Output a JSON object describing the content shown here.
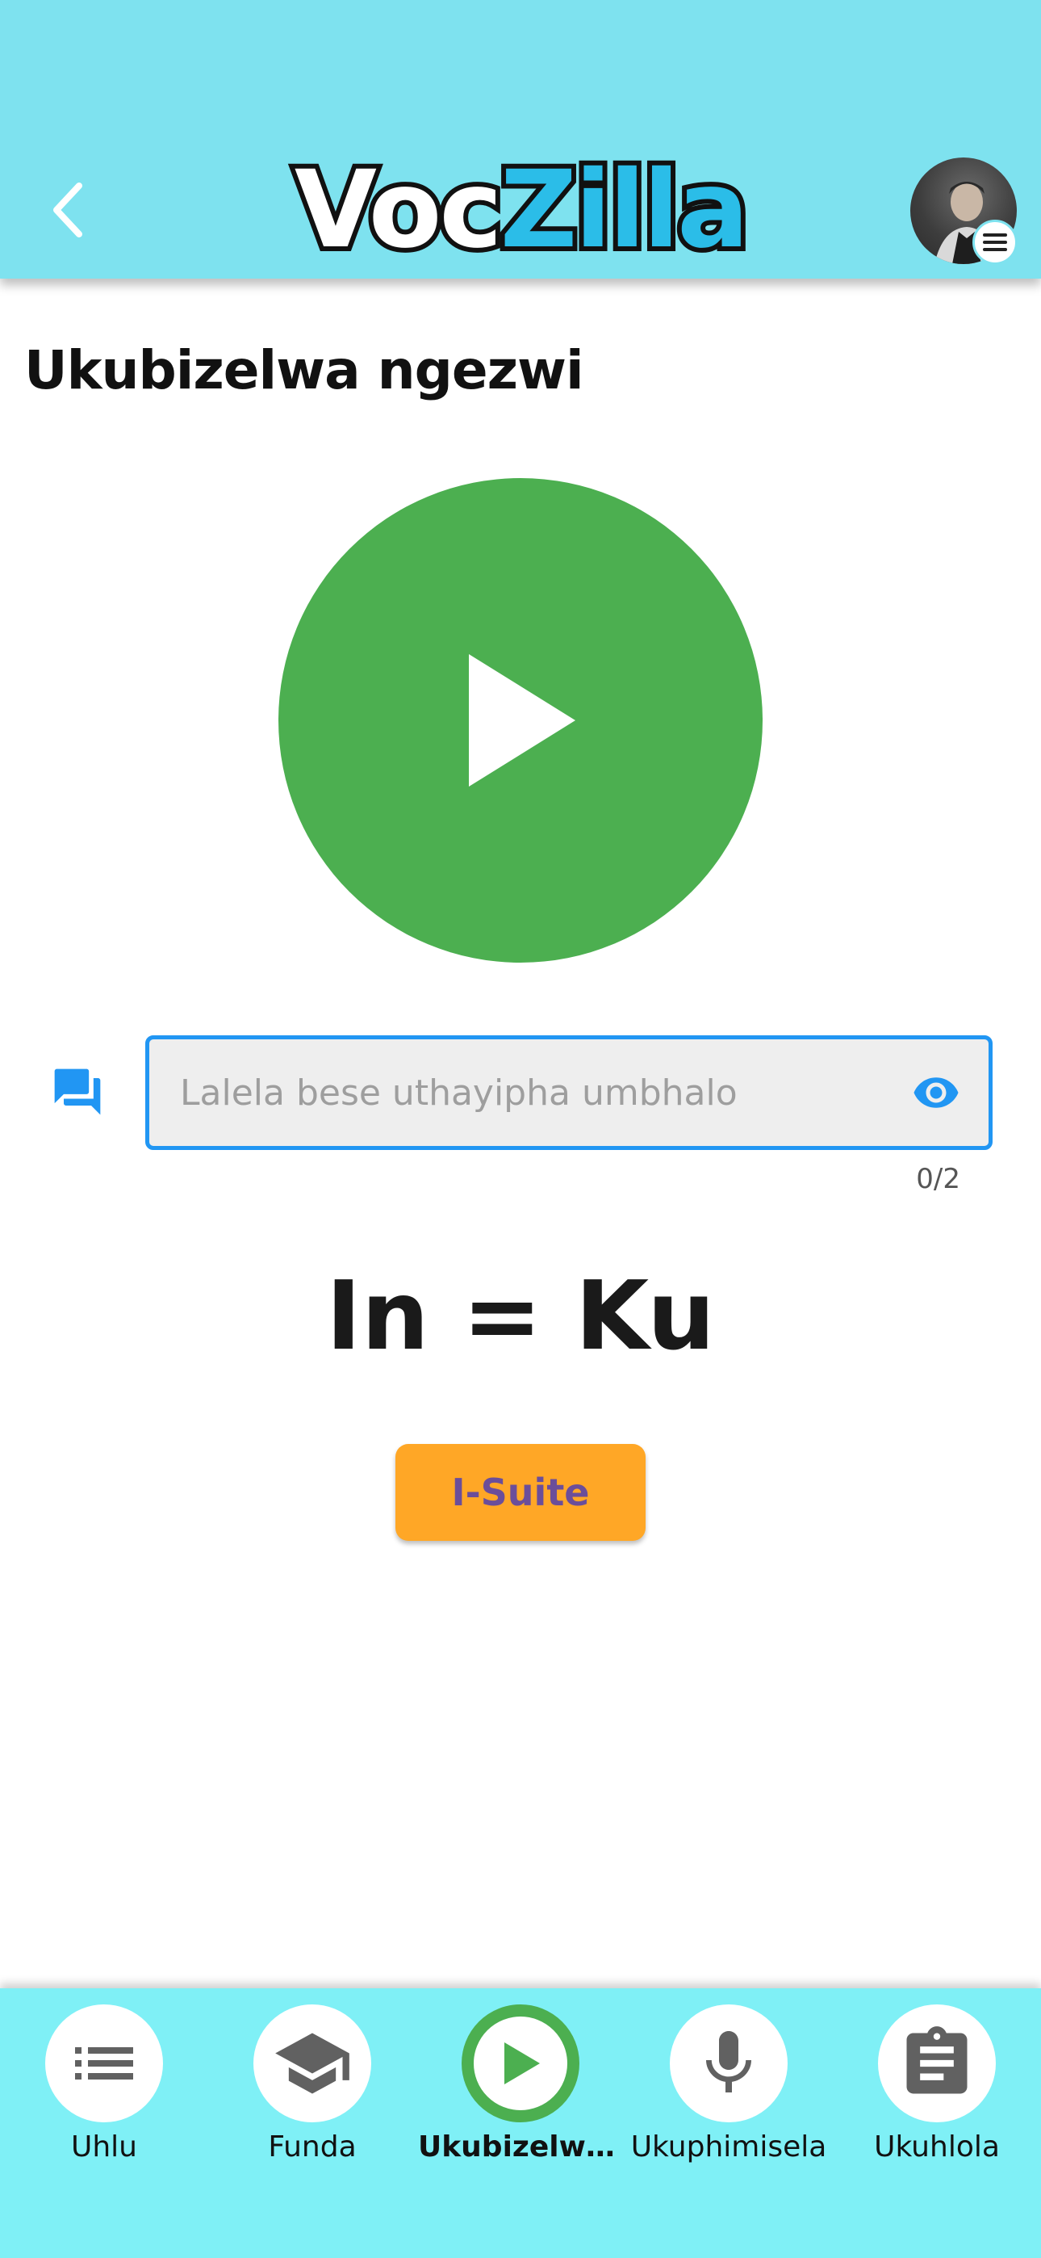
{
  "header": {
    "logo_part1": "Voc",
    "logo_part2": "Zilla",
    "back_icon": "chevron-left-icon",
    "avatar_badge_icon": "menu-icon"
  },
  "page": {
    "title": "Ukubizelwa ngezwi"
  },
  "player": {
    "icon": "play-icon"
  },
  "answer": {
    "placeholder": "Lalela bese uthayipha umbhalo",
    "value": "",
    "counter": "0/2",
    "left_icon": "chat-bubbles-icon",
    "reveal_icon": "eye-icon"
  },
  "rule": {
    "text": "In = Ku"
  },
  "hint_button": {
    "label": "I-Suite"
  },
  "bottom_nav": {
    "active_index": 2,
    "items": [
      {
        "label": "Uhlu",
        "icon": "list-icon"
      },
      {
        "label": "Funda",
        "icon": "graduation-cap-icon"
      },
      {
        "label": "Ukubizelwa...",
        "icon": "play-icon"
      },
      {
        "label": "Ukuphimisela",
        "icon": "microphone-icon"
      },
      {
        "label": "Ukuhlola",
        "icon": "clipboard-icon"
      }
    ]
  },
  "colors": {
    "header_bg": "#7ee2ef",
    "nav_bg": "#7ff0f6",
    "play_green": "#4caf50",
    "input_border": "#2196f3",
    "hint_orange": "#ffa726",
    "hint_text": "#6b4e9a",
    "logo_blue": "#2bbde8"
  }
}
